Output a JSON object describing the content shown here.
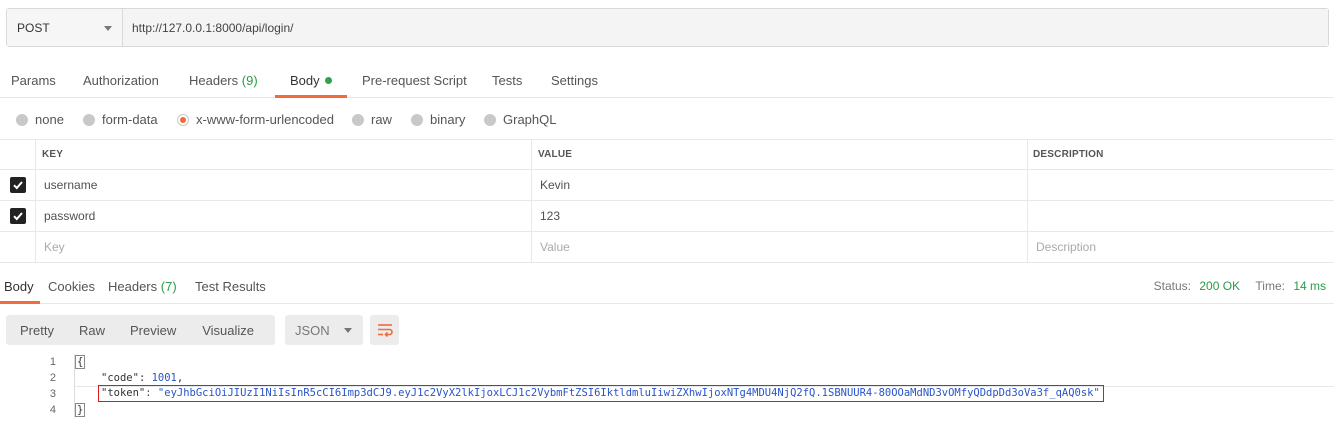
{
  "request": {
    "method": "POST",
    "url": "http://127.0.0.1:8000/api/login/"
  },
  "request_tabs": {
    "params": "Params",
    "authorization": "Authorization",
    "headers": "Headers",
    "headers_count": "(9)",
    "body": "Body",
    "prerequest": "Pre-request Script",
    "tests": "Tests",
    "settings": "Settings"
  },
  "body_types": {
    "none": "none",
    "form_data": "form-data",
    "urlencoded": "x-www-form-urlencoded",
    "raw": "raw",
    "binary": "binary",
    "graphql": "GraphQL",
    "selected": "x-www-form-urlencoded"
  },
  "params_table": {
    "headers": {
      "key": "KEY",
      "value": "VALUE",
      "description": "DESCRIPTION"
    },
    "rows": [
      {
        "checked": true,
        "key": "username",
        "value": "Kevin",
        "description": ""
      },
      {
        "checked": true,
        "key": "password",
        "value": "123",
        "description": ""
      }
    ],
    "placeholders": {
      "key": "Key",
      "value": "Value",
      "description": "Description"
    }
  },
  "response_tabs": {
    "body": "Body",
    "cookies": "Cookies",
    "headers": "Headers",
    "headers_count": "(7)",
    "test_results": "Test Results"
  },
  "status": {
    "status_label": "Status:",
    "status_value": "200 OK",
    "time_label": "Time:",
    "time_value": "14 ms"
  },
  "response_toolbar": {
    "pretty": "Pretty",
    "raw": "Raw",
    "preview": "Preview",
    "visualize": "Visualize",
    "language": "JSON"
  },
  "response_code": {
    "line_numbers": [
      "1",
      "2",
      "3",
      "4"
    ],
    "open_brace": "{",
    "close_brace": "}",
    "code_key": "\"code\"",
    "code_value": "1001",
    "token_key": "\"token\"",
    "token_value": "\"eyJhbGciOiJIUzI1NiIsInR5cCI6Imp3dCJ9.eyJ1c2VyX2lkIjoxLCJ1c2VybmFtZSI6IktldmluIiwiZXhwIjoxNTg4MDU4NjQ2fQ.1SBNUUR4-80OOaMdND3vOMfyQDdpDd3oVa3f_qAQ0sk\""
  },
  "colors": {
    "accent": "#f26b3a",
    "success": "#2c9a4a",
    "highlight_border": "#e0161b",
    "json_value": "#2a54c8"
  }
}
